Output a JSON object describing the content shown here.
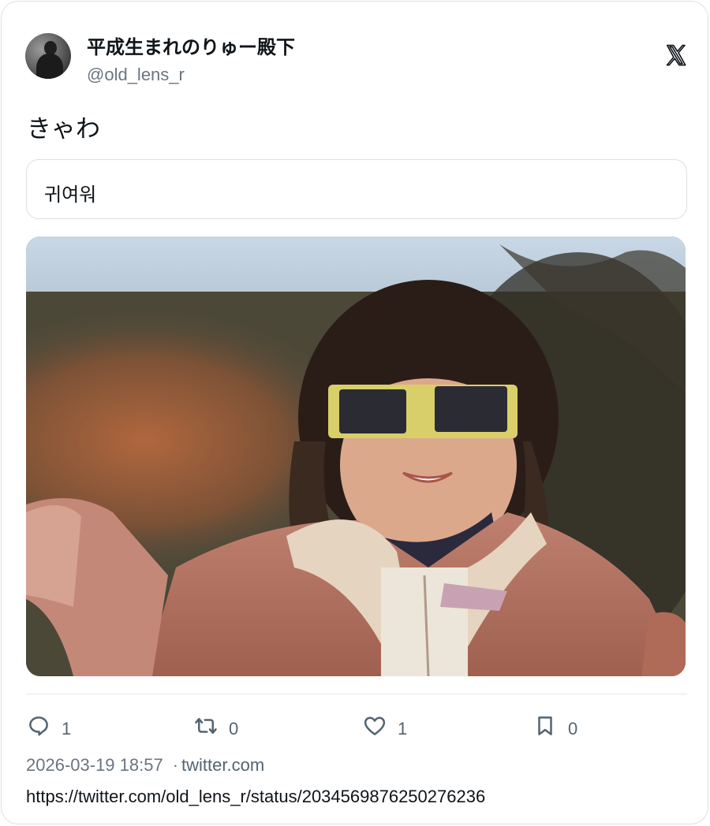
{
  "author": {
    "display_name": "平成生まれのりゅー殿下",
    "handle": "@old_lens_r"
  },
  "platform_icon": "x-logo-icon",
  "tweet": {
    "text": "きゃわ",
    "translation": "귀여워"
  },
  "media": {
    "description_icon": "photo"
  },
  "actions": {
    "reply": {
      "icon": "reply-bubble-icon",
      "count": "1"
    },
    "retweet": {
      "icon": "retweet-icon",
      "count": "0"
    },
    "like": {
      "icon": "heart-icon",
      "count": "1"
    },
    "bookmark": {
      "icon": "bookmark-icon",
      "count": "0"
    }
  },
  "meta": {
    "timestamp": "2026-03-19 18:57",
    "separator": "·",
    "source": "twitter.com"
  },
  "url": "https://twitter.com/old_lens_r/status/2034569876250276236",
  "colors": {
    "text": "#0f1419",
    "secondary": "#6b7580",
    "border": "#dcdfe3"
  }
}
